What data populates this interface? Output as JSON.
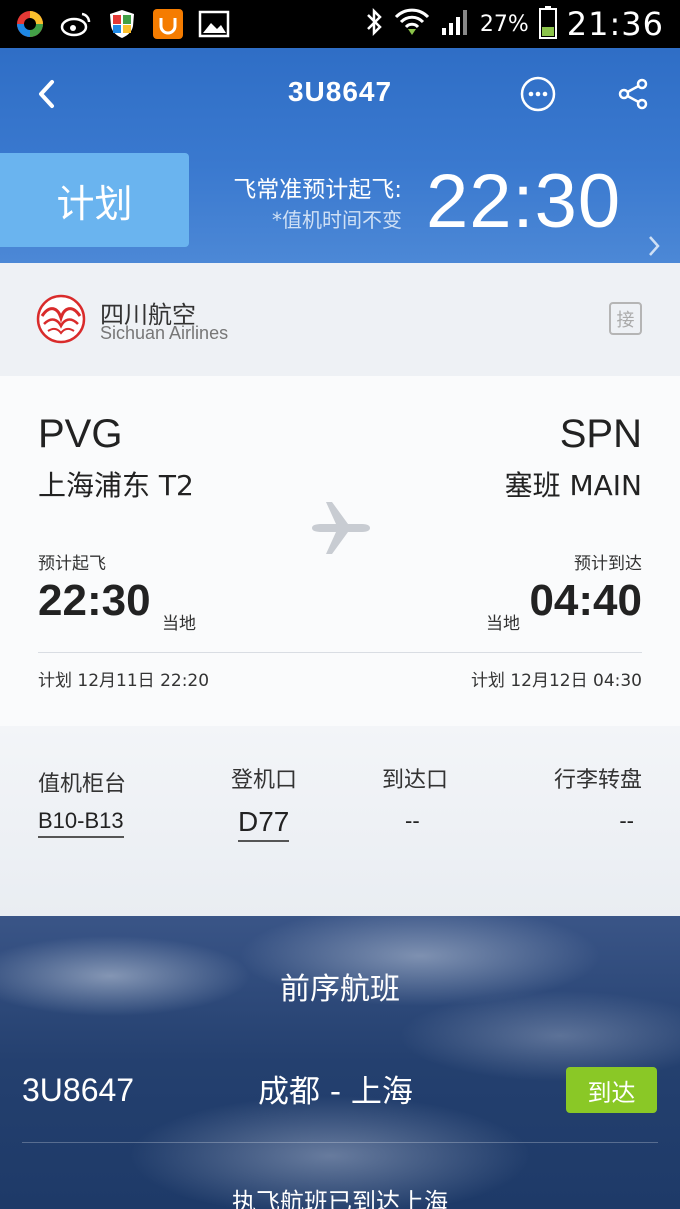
{
  "status_bar": {
    "battery": "27%",
    "clock": "21:36"
  },
  "nav": {
    "title": "3U8647"
  },
  "flight_status": {
    "tag": "计划",
    "estimate_label": "飞常准预计起飞:",
    "estimate_note": "*值机时间不变",
    "estimate_time": "22:30"
  },
  "airline": {
    "name_cn": "四川航空",
    "name_en": "Sichuan Airlines",
    "pickup_label": "接"
  },
  "route": {
    "origin_code": "PVG",
    "origin_city": "上海浦东  T2",
    "dest_code": "SPN",
    "dest_city": "塞班  MAIN",
    "dep_label": "预计起飞",
    "arr_label": "预计到达",
    "dep_time": "22:30",
    "arr_time": "04:40",
    "local_label": "当地",
    "dep_plan": "计划 12月11日 22:20",
    "arr_plan": "计划 12月12日 04:30"
  },
  "gates": {
    "checkin_label": "值机柜台",
    "checkin_value": "B10-B13",
    "boarding_label": "登机口",
    "boarding_value": "D77",
    "arrival_gate_label": "到达口",
    "arrival_gate_value": "--",
    "baggage_label": "行李转盘",
    "baggage_value": "--"
  },
  "previous_flight": {
    "title": "前序航班",
    "flight_no": "3U8647",
    "route": "成都 - 上海",
    "status": "到达",
    "note": "执飞航班已到达上海"
  },
  "colors": {
    "header_blue": "#2f6ec6",
    "status_tag": "#6ab4ef",
    "arrived_badge": "#8ac826",
    "airline_red": "#d92b2b"
  }
}
